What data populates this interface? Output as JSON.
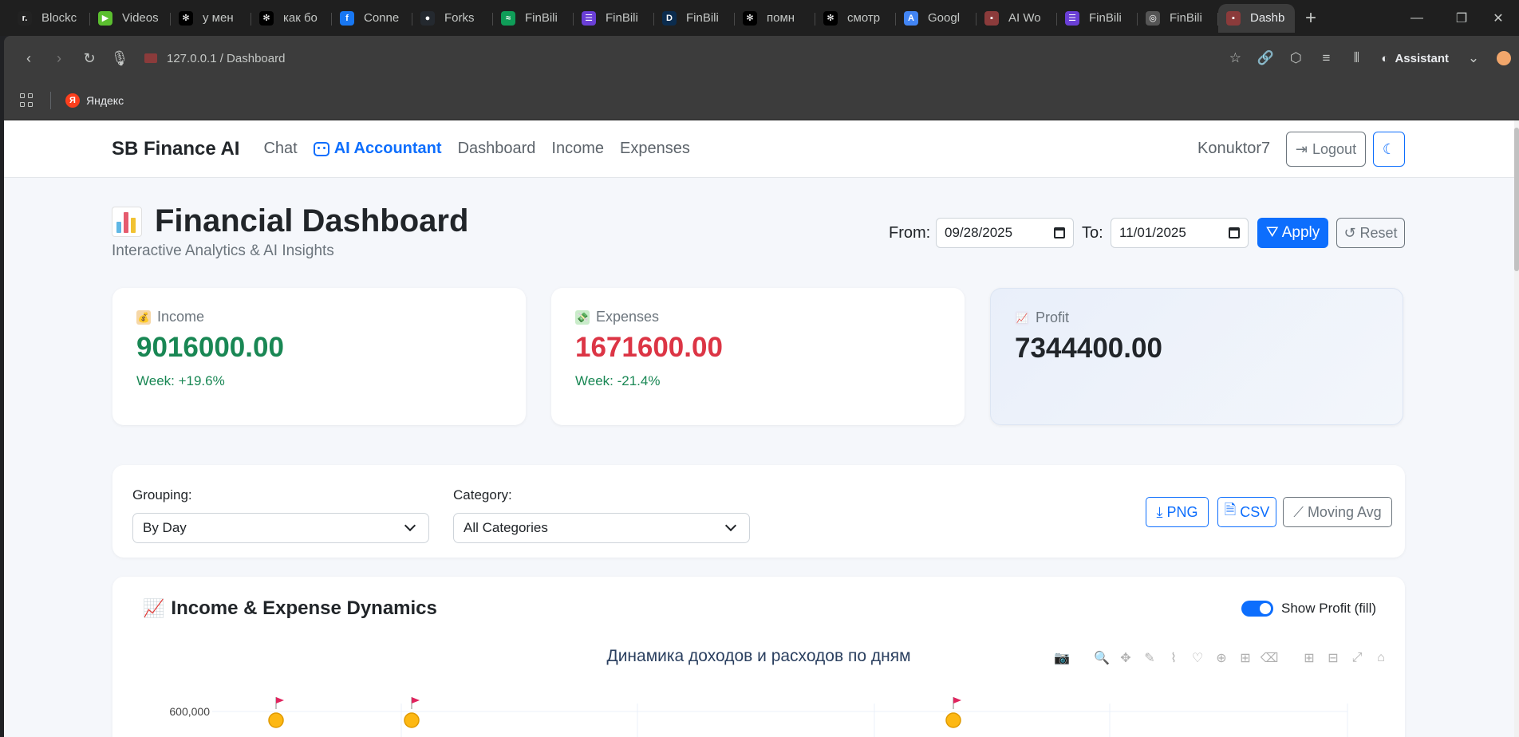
{
  "browser": {
    "tabs": [
      {
        "title": "Blockc",
        "fav_color": "#222222",
        "fav_char": "r."
      },
      {
        "title": "Videos",
        "fav_color": "#5bbf2f",
        "fav_char": "▶"
      },
      {
        "title": "у мен",
        "fav_color": "#000000",
        "fav_char": "✻"
      },
      {
        "title": "как бо",
        "fav_color": "#000000",
        "fav_char": "✻"
      },
      {
        "title": "Conne",
        "fav_color": "#1877f2",
        "fav_char": "f"
      },
      {
        "title": "Forks",
        "fav_color": "#24292f",
        "fav_char": "●"
      },
      {
        "title": "FinBili",
        "fav_color": "#0f9d58",
        "fav_char": "≈"
      },
      {
        "title": "FinBili",
        "fav_color": "#6a3fd6",
        "fav_char": "☰"
      },
      {
        "title": "FinBili",
        "fav_color": "#0b2c4e",
        "fav_char": "D"
      },
      {
        "title": "помн",
        "fav_color": "#000000",
        "fav_char": "✻"
      },
      {
        "title": "смотр",
        "fav_color": "#000000",
        "fav_char": "✻"
      },
      {
        "title": "Googl",
        "fav_color": "#4285f4",
        "fav_char": "A"
      },
      {
        "title": "AI Wo",
        "fav_color": "#8b3b3b",
        "fav_char": "▪"
      },
      {
        "title": "FinBili",
        "fav_color": "#6a3fd6",
        "fav_char": "☰"
      },
      {
        "title": "FinBili",
        "fav_color": "#555555",
        "fav_char": "◎"
      }
    ],
    "active_tab": {
      "title": "Dashb",
      "fav_color": "#8b3b3b",
      "fav_char": "▪"
    },
    "url": "127.0.0.1 / Dashboard",
    "assistant_label": "Assistant",
    "bookmark": "Яндекс"
  },
  "nav": {
    "brand": "SB Finance AI",
    "links": [
      "Chat",
      "AI Accountant",
      "Dashboard",
      "Income",
      "Expenses"
    ],
    "active": "AI Accountant",
    "username": "Konuktor7",
    "logout": "Logout"
  },
  "header": {
    "title": "Financial Dashboard",
    "subtitle": "Interactive Analytics & AI Insights",
    "from_label": "From:",
    "to_label": "To:",
    "from_value": "09/28/2025",
    "to_value": "11/01/2025",
    "apply": "Apply",
    "reset": "Reset"
  },
  "cards": {
    "income": {
      "label": "Income",
      "value": "9016000.00",
      "week": "Week: +19.6%",
      "color": "#198754"
    },
    "expenses": {
      "label": "Expenses",
      "value": "1671600.00",
      "week": "Week: -21.4%",
      "color": "#dc3545"
    },
    "profit": {
      "label": "Profit",
      "value": "7344400.00",
      "color": "#212529"
    }
  },
  "filters": {
    "grouping_label": "Grouping:",
    "grouping_value": "By Day",
    "category_label": "Category:",
    "category_value": "All Categories",
    "png": "PNG",
    "csv": "CSV",
    "moving_avg": "Moving Avg"
  },
  "chart": {
    "card_title": "Income & Expense Dynamics",
    "toggle_label": "Show Profit (fill)",
    "plot_title": "Динамика доходов и расходов по дням",
    "modebar_icons": [
      "camera-icon",
      "zoom-icon",
      "pan-icon",
      "lasso-icon",
      "select-icon",
      "zoom-in-icon",
      "zoom-out-icon",
      "autoscale-icon",
      "reset-axes-icon"
    ]
  },
  "chart_data": {
    "type": "line",
    "title": "Динамика доходов и расходов по дням",
    "ytick_labels": [
      "600,000"
    ],
    "marker_points": [
      {
        "marker": "flag"
      },
      {
        "marker": "flag"
      },
      {
        "marker": "flag"
      }
    ]
  }
}
